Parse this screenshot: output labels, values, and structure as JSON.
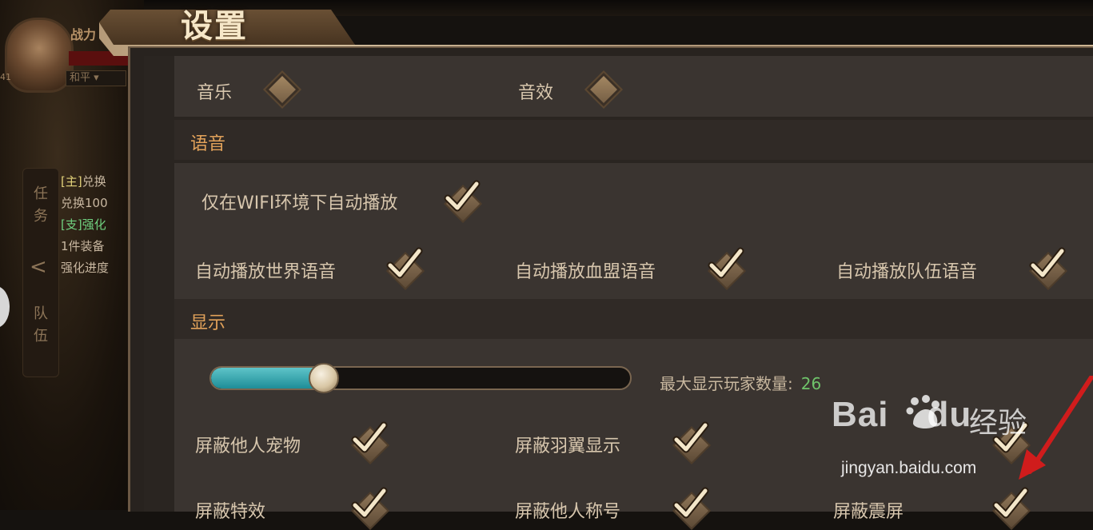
{
  "hud": {
    "power_label": "战力",
    "mode_select": "和平",
    "level": "41",
    "side_tab_task": "任务",
    "side_tab_team": "队伍",
    "quest_lines": [
      {
        "tag": "[主]",
        "text": "兑换"
      },
      {
        "tag": "",
        "text": "兑换100"
      },
      {
        "tag": "[支]",
        "text": "强化"
      },
      {
        "tag": "",
        "text": "1件装备"
      },
      {
        "tag": "",
        "text": "强化进度"
      }
    ]
  },
  "window": {
    "title": "设置"
  },
  "audio": {
    "music_label": "音乐",
    "sfx_label": "音效"
  },
  "voice": {
    "section_title": "语音",
    "wifi_only_label": "仅在WIFI环境下自动播放",
    "auto_world_label": "自动播放世界语音",
    "auto_guild_label": "自动播放血盟语音",
    "auto_team_label": "自动播放队伍语音",
    "wifi_only_checked": true,
    "auto_world_checked": true,
    "auto_guild_checked": true,
    "auto_team_checked": true
  },
  "display": {
    "section_title": "显示",
    "max_players_label": "最大显示玩家数量:",
    "max_players_value": "26",
    "slider_fraction": 0.27,
    "hide_pets_label": "屏蔽他人宠物",
    "hide_wings_label": "屏蔽羽翼显示",
    "hide_effects_label": "屏蔽特效",
    "hide_titles_label": "屏蔽他人称号",
    "hide_shake_label": "屏蔽震屏",
    "hide_pets_checked": true,
    "hide_wings_checked": true,
    "hide_effects_checked": true,
    "hide_titles_checked": true,
    "hide_shake_checked": true
  },
  "watermark": {
    "brand": "Bai",
    "brand_suffix": "du",
    "jingyan": "经验",
    "url": "jingyan.baidu.com"
  },
  "colors": {
    "section_title": "#e2a25a",
    "label": "#d7c6ad",
    "slider_fill": "#2aa5ae",
    "max_players_value": "#6fc36a"
  }
}
